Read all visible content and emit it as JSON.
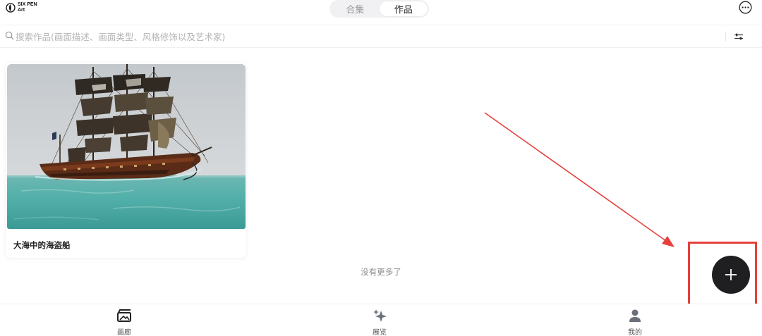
{
  "header": {
    "logo_line1": "SIX PEN",
    "logo_line2": "Art",
    "tabs": [
      {
        "label": "合集",
        "active": false
      },
      {
        "label": "作品",
        "active": true
      }
    ],
    "more_icon": "more-horizontal-circle-icon"
  },
  "search": {
    "placeholder": "搜索作品(画面描述、画面类型、风格修饰以及艺术家)",
    "value": "",
    "icon": "search-icon",
    "filter_icon": "sliders-icon"
  },
  "gallery": {
    "items": [
      {
        "title": "大海中的海盗船",
        "image": "pirate-ship-at-sea-image"
      }
    ],
    "end_text": "没有更多了"
  },
  "fab": {
    "icon": "plus-icon",
    "color": "#1f1f22"
  },
  "annotation": {
    "color": "#e5403c"
  },
  "bottom_nav": [
    {
      "label": "画廊",
      "icon": "gallery-icon",
      "active": true
    },
    {
      "label": "展览",
      "icon": "sparkle-icon",
      "active": false
    },
    {
      "label": "我的",
      "icon": "user-icon",
      "active": false
    }
  ]
}
